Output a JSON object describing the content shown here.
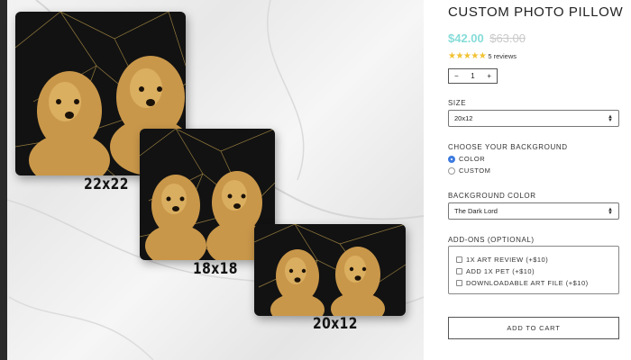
{
  "product": {
    "title": "CUSTOM PHOTO PILLOW",
    "price": "$42.00",
    "compare_price": "$63.00",
    "stars": "★★★★★",
    "reviews": "5 reviews",
    "quantity": {
      "minus": "−",
      "value": "1",
      "plus": "+"
    }
  },
  "options": {
    "size_label": "SIZE",
    "size_value": "20x12",
    "background_label": "CHOOSE YOUR BACKGROUND",
    "background_choices": [
      "COLOR",
      "CUSTOM"
    ],
    "background_selected": "COLOR",
    "bg_color_label": "BACKGROUND COLOR",
    "bg_color_value": "The Dark Lord",
    "addons_label": "ADD-ONS (OPTIONAL)",
    "addons": [
      "1X ART REVIEW (+$10)",
      "ADD 1X PET (+$10)",
      "DOWNLOADABLE ART FILE (+$10)"
    ]
  },
  "cart_button": "ADD TO CART",
  "pillow_sizes": [
    "22x22",
    "18x18",
    "20x12"
  ],
  "colors": {
    "price": "#86dcd8",
    "stars": "#f2c230",
    "radio": "#3d7be0"
  }
}
